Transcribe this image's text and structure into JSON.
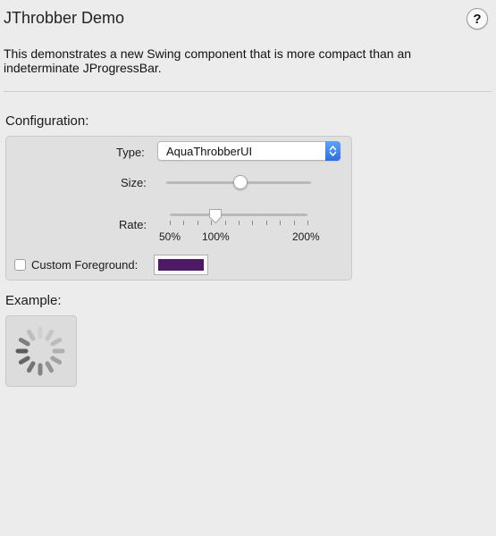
{
  "window": {
    "title": "JThrobber Demo",
    "help_label": "?"
  },
  "description": "This demonstrates a new Swing component that is more compact than an indeterminate JProgressBar.",
  "configuration": {
    "heading": "Configuration:",
    "type_label": "Type:",
    "type_value": "AquaThrobberUI",
    "size_label": "Size:",
    "size_fraction": 0.51,
    "rate_label": "Rate:",
    "rate_tick_labels": [
      "50%",
      "100%",
      "200%"
    ],
    "rate_value": "100%",
    "custom_foreground_label": "Custom Foreground:",
    "custom_foreground_checked": false,
    "foreground_color": "#4e1a66"
  },
  "example": {
    "heading": "Example:",
    "throbber_icon": "spinner-icon"
  }
}
